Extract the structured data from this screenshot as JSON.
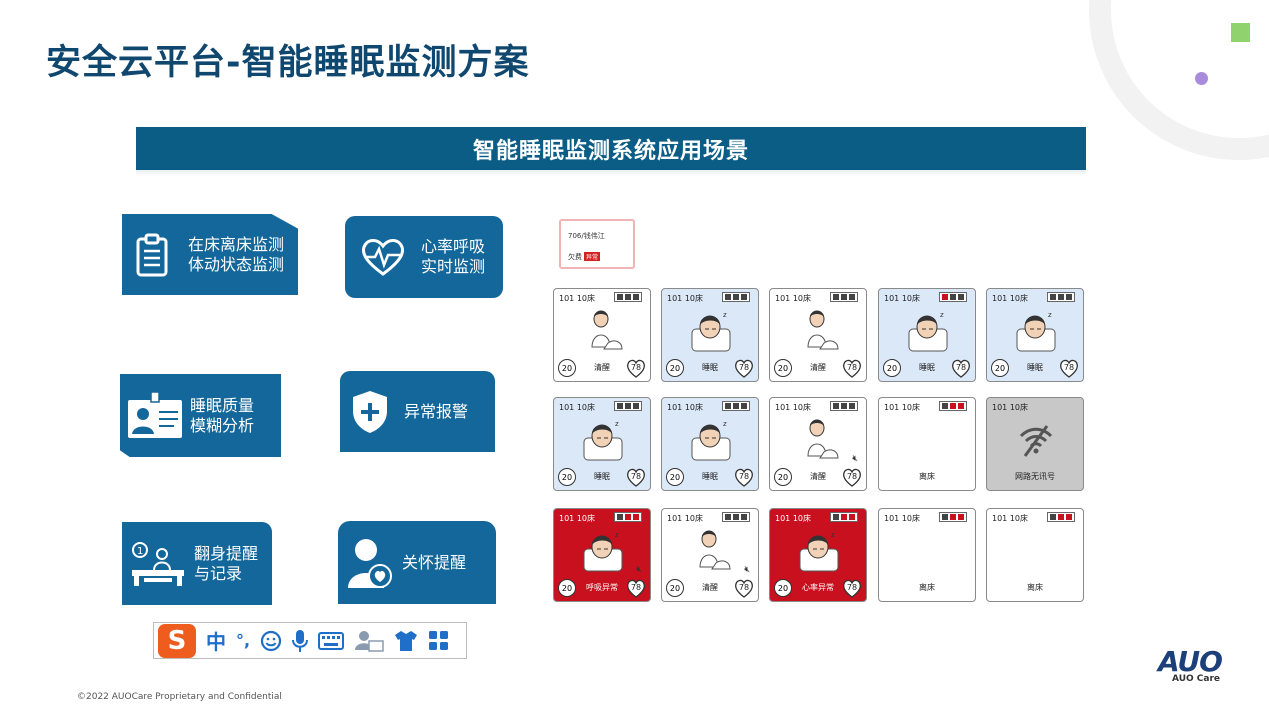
{
  "page": {
    "title": "安全云平台-智能睡眠监测方案",
    "banner": "智能睡眠监测系统应用场景",
    "footer": "©2022 AUOCare Proprietary and Confidential"
  },
  "brand": {
    "logo_text": "AUO",
    "logo_sub": "AUO Care",
    "primary_color": "#0b5d85",
    "title_color": "#10476e",
    "alert_color": "#c8101f"
  },
  "feature_cards": [
    {
      "icon": "clipboard-icon",
      "line1": "在床离床监测",
      "line2": "体动状态监测"
    },
    {
      "icon": "heartbeat-icon",
      "line1": "心率呼吸",
      "line2": "实时监测"
    },
    {
      "icon": "badge-id-icon",
      "line1": "睡眠质量",
      "line2": "模糊分析"
    },
    {
      "icon": "shield-plus-icon",
      "line1": "异常报警",
      "line2": ""
    },
    {
      "icon": "turnover-icon",
      "line1": "翻身提醒",
      "line2": "与记录"
    },
    {
      "icon": "care-person-icon",
      "line1": "关怀提醒",
      "line2": ""
    }
  ],
  "alert_card": {
    "room": "706/钱伟江",
    "label": "欠费",
    "badge": "异常"
  },
  "beds": [
    {
      "label": "101 10床",
      "bg": "white",
      "status": "清醒",
      "left": "20",
      "right": "78",
      "person": "sitting"
    },
    {
      "label": "101 10床",
      "bg": "blue",
      "status": "睡眠",
      "left": "20",
      "right": "78",
      "person": "sleeping"
    },
    {
      "label": "101 10床",
      "bg": "white",
      "status": "清醒",
      "left": "20",
      "right": "78",
      "person": "sitting"
    },
    {
      "label": "101 10床",
      "bg": "blue",
      "status": "睡眠",
      "left": "20",
      "right": "78",
      "person": "sleeping"
    },
    {
      "label": "101 10床",
      "bg": "blue",
      "status": "睡眠",
      "left": "20",
      "right": "78",
      "person": "sleeping"
    },
    {
      "label": "101 10床",
      "bg": "blue",
      "status": "睡眠",
      "left": "20",
      "right": "78",
      "person": "sleeping"
    },
    {
      "label": "101 10床",
      "bg": "blue",
      "status": "睡眠",
      "left": "20",
      "right": "78",
      "person": "sleeping"
    },
    {
      "label": "101 10床",
      "bg": "white",
      "status": "清醒",
      "left": "20",
      "right": "78",
      "person": "sitting",
      "muted": true
    },
    {
      "label": "101 10床",
      "bg": "white",
      "status": "离床",
      "left": "",
      "right": "",
      "person": "none"
    },
    {
      "label": "101 10床",
      "bg": "gray",
      "status": "网路无讯号",
      "left": "",
      "right": "",
      "person": "wifi"
    },
    {
      "label": "101 10床",
      "bg": "red",
      "status": "呼吸异常",
      "left": "20",
      "right": "78",
      "person": "sleeping",
      "muted": true
    },
    {
      "label": "101 10床",
      "bg": "white",
      "status": "清醒",
      "left": "20",
      "right": "78",
      "person": "sitting",
      "muted": true
    },
    {
      "label": "101 10床",
      "bg": "red",
      "status": "心率异常",
      "left": "20",
      "right": "78",
      "person": "sleeping"
    },
    {
      "label": "101 10床",
      "bg": "white",
      "status": "离床",
      "left": "",
      "right": "",
      "person": "none"
    },
    {
      "label": "101 10床",
      "bg": "white",
      "status": "离床",
      "left": "",
      "right": "",
      "person": "none"
    }
  ],
  "ime_toolbar": {
    "logo": "S",
    "items": [
      {
        "icon": "chinese-mode-icon",
        "text": "中"
      },
      {
        "icon": "punctuation-icon",
        "text": "°,"
      },
      {
        "icon": "emoji-icon",
        "text": ""
      },
      {
        "icon": "microphone-icon",
        "text": ""
      },
      {
        "icon": "keyboard-icon",
        "text": ""
      },
      {
        "icon": "user-card-icon",
        "text": ""
      },
      {
        "icon": "shirt-icon",
        "text": ""
      },
      {
        "icon": "grid-apps-icon",
        "text": ""
      }
    ]
  }
}
